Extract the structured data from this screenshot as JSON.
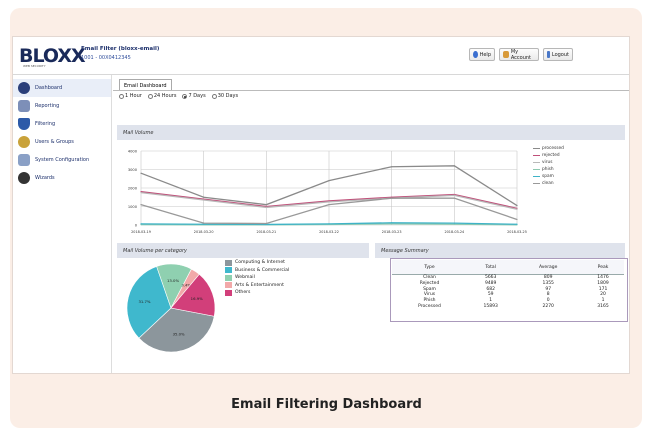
{
  "header": {
    "logo": "BLOXX",
    "logo_sub": "WEB SECURITY",
    "title": "Email Filter (bloxx-email)",
    "subtitle": "1001 - 00X0412345",
    "buttons": [
      {
        "label": "Help",
        "icon": "help-icon"
      },
      {
        "label": "My Account",
        "icon": "account-icon"
      },
      {
        "label": "Logout",
        "icon": "logout-icon"
      }
    ]
  },
  "sidebar": {
    "items": [
      {
        "label": "Dashboard",
        "icon": "dashboard-icon",
        "color": "#2b3f7a"
      },
      {
        "label": "Reporting",
        "icon": "reporting-icon",
        "color": "#7d8fb8"
      },
      {
        "label": "Filtering",
        "icon": "filtering-icon",
        "color": "#2d5aa8"
      },
      {
        "label": "Users & Groups",
        "icon": "users-icon",
        "color": "#c9a23a"
      },
      {
        "label": "System Configuration",
        "icon": "system-config-icon",
        "color": "#8aa0c6"
      },
      {
        "label": "Wizards",
        "icon": "wizards-icon",
        "color": "#333333"
      }
    ]
  },
  "main": {
    "tab": "Email Dashboard",
    "ranges": [
      {
        "label": "1 Hour",
        "selected": false
      },
      {
        "label": "24 Hours",
        "selected": false
      },
      {
        "label": "7 Days",
        "selected": true
      },
      {
        "label": "30 Days",
        "selected": false
      }
    ],
    "mail_volume_title": "Mail Volume",
    "category_title": "Mail Volume per category",
    "summary_title": "Message Summary"
  },
  "chart_data": [
    {
      "type": "line",
      "title": "Mail Volume",
      "x": [
        "2018-03-19",
        "2018-03-20",
        "2018-03-21",
        "2018-03-22",
        "2018-03-23",
        "2018-03-24",
        "2018-03-25"
      ],
      "ylim": [
        0,
        4000
      ],
      "yticks": [
        0,
        1000,
        2000,
        3000,
        4000
      ],
      "grid": true,
      "legend": "right",
      "series": [
        {
          "name": "processed",
          "color": "#8a8a8a",
          "values": [
            2800,
            1500,
            1100,
            2400,
            3150,
            3200,
            1050
          ]
        },
        {
          "name": "rejected",
          "color": "#c0507a",
          "values": [
            1800,
            1400,
            1000,
            1300,
            1500,
            1650,
            900
          ]
        },
        {
          "name": "virus",
          "color": "#b9b9b9",
          "values": [
            1750,
            1350,
            950,
            1250,
            1450,
            1600,
            850
          ]
        },
        {
          "name": "phish",
          "color": "#8fc9b0",
          "values": [
            20,
            10,
            10,
            30,
            60,
            40,
            10
          ]
        },
        {
          "name": "spam",
          "color": "#3fb3c7",
          "values": [
            60,
            40,
            30,
            60,
            120,
            100,
            40
          ]
        },
        {
          "name": "clean",
          "color": "#999999",
          "values": [
            1100,
            100,
            80,
            1100,
            1450,
            1450,
            300
          ]
        }
      ]
    },
    {
      "type": "pie",
      "title": "Mail Volume per category",
      "legend": "right",
      "slices": [
        {
          "name": "Computing & Internet",
          "value": 35.0,
          "label": "35.0%",
          "color": "#8c969c"
        },
        {
          "name": "Business & Commercial",
          "value": 31.7,
          "label": "31.7%",
          "color": "#3fb8cd"
        },
        {
          "name": "Webmail",
          "value": 13.0,
          "label": "13.0%",
          "color": "#8fd0b0"
        },
        {
          "name": "Arts & Entertainment",
          "value": 3.4,
          "label": "3.4%",
          "color": "#f2a9a9"
        },
        {
          "name": "Others",
          "value": 16.9,
          "label": "16.9%",
          "color": "#d23f7a"
        }
      ]
    },
    {
      "type": "table",
      "title": "Message Summary",
      "columns": [
        "Type",
        "Total",
        "Average",
        "Peak"
      ],
      "rows": [
        [
          "Clean",
          "5663",
          "809",
          "1476"
        ],
        [
          "Rejected",
          "9489",
          "1355",
          "1809"
        ],
        [
          "Spam",
          "682",
          "97",
          "171"
        ],
        [
          "Virus",
          "59",
          "8",
          "20"
        ],
        [
          "Phish",
          "1",
          "0",
          "1"
        ],
        [
          "Processed",
          "15893",
          "2270",
          "3165"
        ]
      ]
    }
  ],
  "caption": "Email Filtering Dashboard"
}
